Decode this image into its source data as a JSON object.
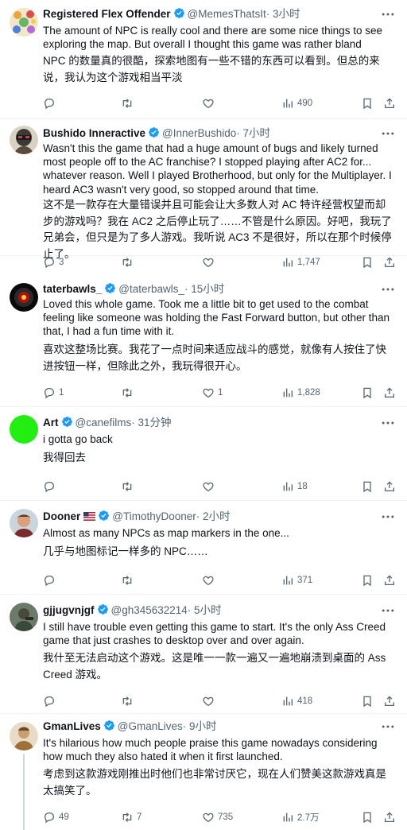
{
  "colors": {
    "verified": "#1d9bf0",
    "text": "#0f1419",
    "muted": "#536471",
    "divider": "#eff3f4"
  },
  "tweets": [
    {
      "name": "Registered Flex Offender",
      "handle": "@MemesThatsIt",
      "time": "· 3小时",
      "body": "The amount of NPC is really cool and there are some nice things to see exploring the map. But overall I thought this game was rather bland",
      "translation": "NPC 的数量真的很酷，探索地图有一些不错的东西可以看到。但总的来说，我认为这个游戏相当平淡",
      "replies": "",
      "retweets": "",
      "likes": "",
      "views": "490"
    },
    {
      "name": "Bushido Inneractive",
      "handle": "@InnerBushido",
      "time": "· 7小时",
      "body": "Wasn't this the game that had a huge amount of bugs and likely turned most people off to the AC franchise? I stopped playing after AC2 for... whatever reason. Well I played Brotherhood, but only for the Multiplayer. I heard AC3 wasn't very good, so stopped around that time.",
      "translation": "这不是一款存在大量错误并且可能会让大多数人对 AC 特许经营权望而却步的游戏吗？我在 AC2 之后停止玩了……不管是什么原因。好吧，我玩了兄弟会，但只是为了多人游戏。我听说 AC3 不是很好，所以在那个时候停止了。",
      "replies": "3",
      "retweets": "",
      "likes": "",
      "views": "1,747"
    },
    {
      "name": "taterbawls_",
      "handle": "@taterbawls_",
      "time": "· 15小时",
      "body": "Loved this whole game.  Took me a little bit to get used to the combat feeling like someone was holding the Fast Forward button, but other than that, I had a fun time with it.",
      "translation": "喜欢这整场比赛。我花了一点时间来适应战斗的感觉，就像有人按住了快进按钮一样，但除此之外，我玩得很开心。",
      "replies": "1",
      "retweets": "",
      "likes": "1",
      "views": "1,828"
    },
    {
      "name": "Art",
      "handle": "@canefilms",
      "time": "· 31分钟",
      "body": "i gotta go back",
      "translation": "我得回去",
      "replies": "",
      "retweets": "",
      "likes": "",
      "views": "18"
    },
    {
      "name": "Dooner",
      "handle": "@TimothyDooner",
      "time": "· 2小时",
      "body": "Almost as many NPCs as map markers in the one...",
      "translation": "几乎与地图标记一样多的 NPC……",
      "replies": "",
      "retweets": "",
      "likes": "",
      "views": "371"
    },
    {
      "name": "gjjugvnjgf",
      "handle": "@gh345632214",
      "time": "· 5小时",
      "body": "I still have trouble even getting this game to start. It's the only Ass Creed game that just crashes to desktop over and over again.",
      "translation": "我什至无法启动这个游戏。这是唯一一款一遍又一遍地崩溃到桌面的 Ass Creed 游戏。",
      "replies": "",
      "retweets": "",
      "likes": "",
      "views": "418"
    },
    {
      "name": "GmanLives",
      "handle": "@GmanLives",
      "time": "· 9小时",
      "body": "It's hilarious how much people praise this game nowadays considering how much they also hated it when it first launched.",
      "translation": "考虑到这款游戏刚推出时他们也非常讨厌它，现在人们赞美这款游戏真是太搞笑了。",
      "replies": "49",
      "retweets": "7",
      "likes": "735",
      "views": "2.7万"
    }
  ]
}
